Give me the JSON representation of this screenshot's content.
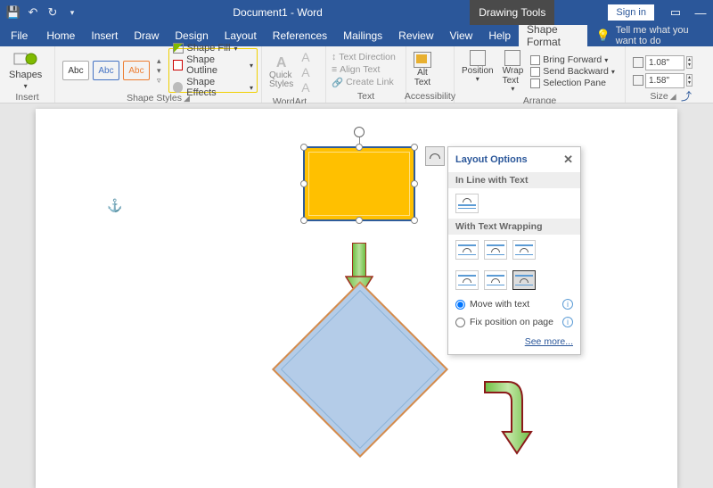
{
  "titlebar": {
    "doc_title": "Document1 - Word",
    "context_tab": "Drawing Tools",
    "sign_in": "Sign in"
  },
  "menu": {
    "file": "File",
    "home": "Home",
    "insert": "Insert",
    "draw": "Draw",
    "design": "Design",
    "layout": "Layout",
    "references": "References",
    "mailings": "Mailings",
    "review": "Review",
    "view": "View",
    "help": "Help",
    "shape_format": "Shape Format",
    "tell_me": "Tell me what you want to do"
  },
  "ribbon": {
    "insert_shapes": {
      "button": "Shapes",
      "label": "Insert Shapes"
    },
    "shape_styles": {
      "abc": "Abc",
      "fill": "Shape Fill",
      "outline": "Shape Outline",
      "effects": "Shape Effects",
      "label": "Shape Styles"
    },
    "wordart": {
      "quick": "Quick\nStyles",
      "label": "WordArt Styles"
    },
    "text": {
      "dir": "Text Direction",
      "align": "Align Text",
      "link": "Create Link",
      "label": "Text"
    },
    "acc": {
      "alt": "Alt\nText",
      "label": "Accessibility"
    },
    "arrange": {
      "position": "Position",
      "wrap": "Wrap\nText",
      "fwd": "Bring Forward",
      "back": "Send Backward",
      "pane": "Selection Pane",
      "label": "Arrange"
    },
    "size": {
      "h": "1.08\"",
      "w": "1.58\"",
      "label": "Size"
    }
  },
  "layout_panel": {
    "title": "Layout Options",
    "inline": "In Line with Text",
    "wrap": "With Text Wrapping",
    "move": "Move with text",
    "fix": "Fix position on page",
    "see_more": "See more..."
  }
}
